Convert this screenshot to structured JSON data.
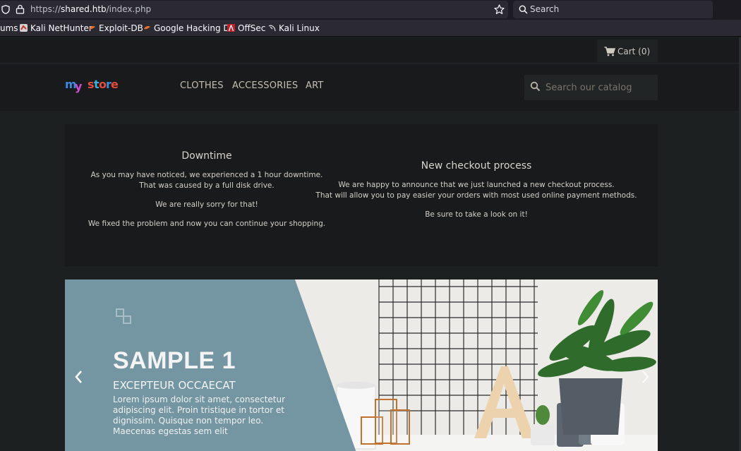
{
  "browser": {
    "url_prefix": "https://",
    "url_host": "shared.htb",
    "url_path": "/index.php",
    "search_placeholder": "Search",
    "bookmarks": [
      {
        "label": "ums",
        "icon": "truncated-item"
      },
      {
        "label": "Kali NetHunter",
        "icon": "kali-nethunter-icon"
      },
      {
        "label": "Exploit-DB",
        "icon": "exploit-db-icon"
      },
      {
        "label": "Google Hacking DB",
        "icon": "ghdb-icon"
      },
      {
        "label": "OffSec",
        "icon": "offsec-icon"
      },
      {
        "label": "Kali Linux",
        "icon": "kali-dragon-icon"
      }
    ]
  },
  "store": {
    "cart_label": "Cart (0)",
    "logo_text": "my store",
    "menu": [
      "CLOTHES",
      "ACCESSORIES",
      "ART"
    ],
    "search_placeholder": "Search our catalog"
  },
  "notices": {
    "left": {
      "title": "Downtime",
      "lines": [
        "As you may have noticed, we experienced a 1 hour downtime.",
        "That was caused by a full disk drive.",
        "We are really sorry for that!",
        "We fixed the problem and now you can continue your shopping."
      ]
    },
    "right": {
      "title": "New checkout process",
      "lines": [
        "We are happy to announce that we just launched a new checkout process.",
        "That will allow you to pay easier your orders with most used online payment methods.",
        "Be sure to take a look on it!"
      ]
    }
  },
  "slide": {
    "title": "SAMPLE 1",
    "subtitle": "EXCEPTEUR OCCAECAT",
    "body": "Lorem ipsum dolor sit amet, consectetur adipiscing elit. Proin tristique in tortor et dignissim. Quisque non tempor leo. Maecenas egestas sem elit"
  },
  "colors": {
    "panel_blue": "#7496a3",
    "header_bg": "#181a1b",
    "page_bg": "#1c2021"
  }
}
